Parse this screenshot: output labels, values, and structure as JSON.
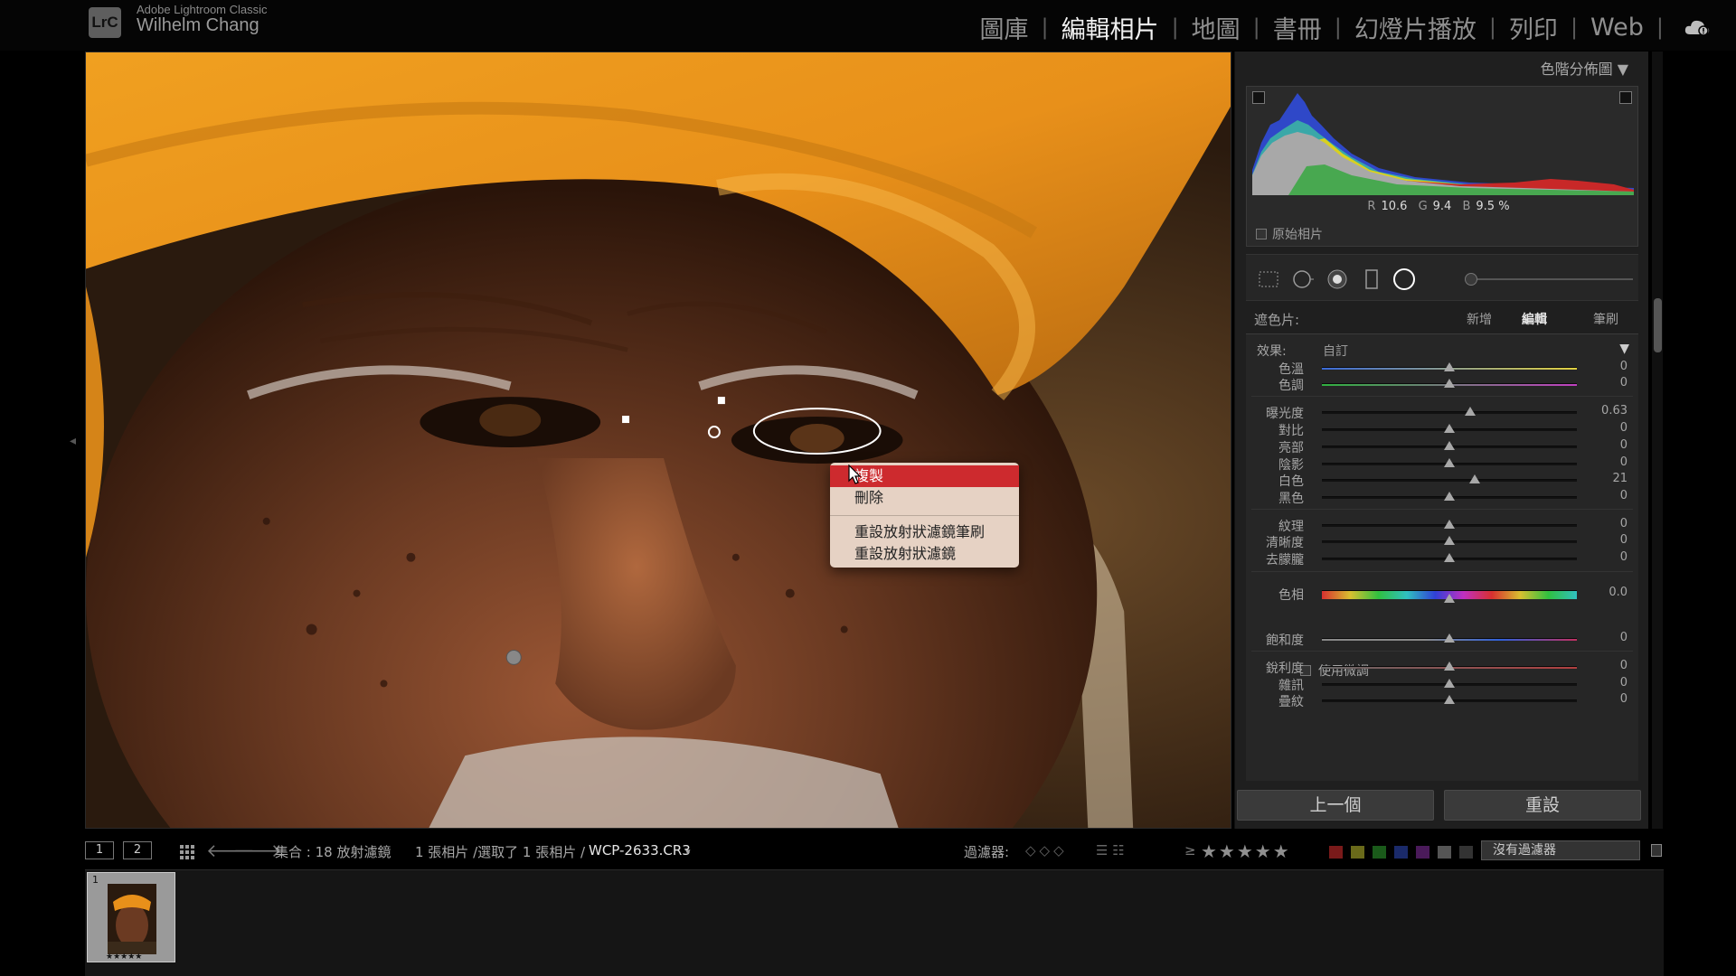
{
  "app": {
    "product": "Adobe Lightroom Classic",
    "logo": "LrC",
    "user": "Wilhelm Chang"
  },
  "modules": [
    {
      "label": "圖庫",
      "active": false
    },
    {
      "label": "編輯相片",
      "active": true
    },
    {
      "label": "地圖",
      "active": false
    },
    {
      "label": "書冊",
      "active": false
    },
    {
      "label": "幻燈片播放",
      "active": false
    },
    {
      "label": "列印",
      "active": false
    },
    {
      "label": "Web",
      "active": false
    }
  ],
  "context_menu": {
    "items": [
      "複製",
      "刪除",
      "重設放射狀濾鏡筆刷",
      "重設放射狀濾鏡"
    ],
    "selected_index": 0
  },
  "histogram": {
    "title": "色階分佈圖",
    "r_label": "R",
    "r_value": "10.6",
    "g_label": "G",
    "g_value": "9.4",
    "b_label": "B",
    "b_value": "9.5 %",
    "original_photo_label": "原始相片"
  },
  "mask": {
    "label": "遮色片:",
    "options": [
      "新增",
      "編輯",
      "筆刷"
    ],
    "active_option": "編輯"
  },
  "effect": {
    "label": "效果:",
    "value": "自訂"
  },
  "sliders": {
    "temp": {
      "label": "色溫",
      "value": "0",
      "position": 0.5
    },
    "tint": {
      "label": "色調",
      "value": "0",
      "position": 0.5
    },
    "exposure": {
      "label": "曝光度",
      "value": "0.63",
      "position": 0.58
    },
    "contrast": {
      "label": "對比",
      "value": "0",
      "position": 0.5
    },
    "highlights": {
      "label": "亮部",
      "value": "0",
      "position": 0.5
    },
    "shadows": {
      "label": "陰影",
      "value": "0",
      "position": 0.5
    },
    "whites": {
      "label": "白色",
      "value": "21",
      "position": 0.6
    },
    "blacks": {
      "label": "黑色",
      "value": "0",
      "position": 0.5
    },
    "texture": {
      "label": "紋理",
      "value": "0",
      "position": 0.5
    },
    "clarity": {
      "label": "清晰度",
      "value": "0",
      "position": 0.5
    },
    "dehaze": {
      "label": "去朦朧",
      "value": "0",
      "position": 0.5
    },
    "hue": {
      "label": "色相",
      "value": "0.0",
      "position": 0.5
    },
    "saturation": {
      "label": "飽和度",
      "value": "0",
      "position": 0.5
    },
    "sharpness": {
      "label": "銳利度",
      "value": "0",
      "position": 0.5
    },
    "noise": {
      "label": "雜訊",
      "value": "0",
      "position": 0.5
    },
    "moire": {
      "label": "疊紋",
      "value": "0",
      "position": 0.5
    }
  },
  "fine_adjust_label": "使用微調",
  "buttons": {
    "previous": "上一個",
    "reset": "重設"
  },
  "filmstrip_bar": {
    "monitor1": "1",
    "monitor2": "2",
    "collection": "集合 : 18 放射濾鏡",
    "selection": "1 張相片 /選取了 1 張相片 /",
    "filename": "WCP-2633.CR3",
    "filter_label": "過濾器:",
    "rating_op": "≥",
    "stars": "★★★★★",
    "filter_value": "沒有過濾器"
  },
  "filmstrip": {
    "thumb_index": "1",
    "thumb_stars": "★★★★★"
  },
  "colors": {
    "accent_selected": "#cd2a2e",
    "turban": "#e8901a",
    "skin": "#6b3a22"
  }
}
